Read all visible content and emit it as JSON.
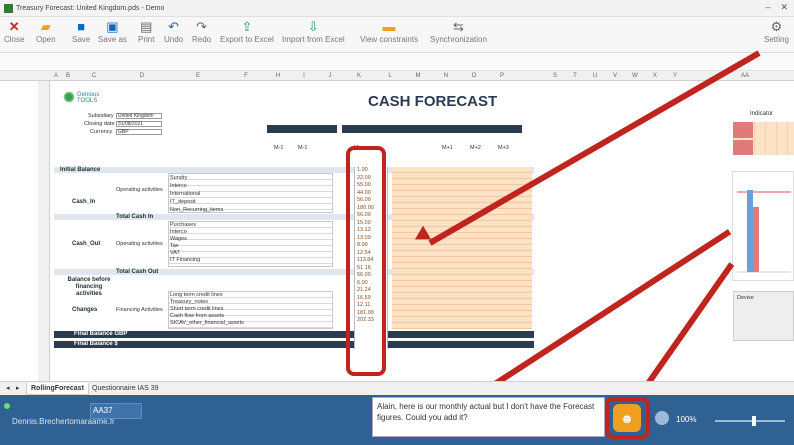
{
  "window": {
    "title": "Treasury Forecast: United Kingdom.pds - Demo",
    "controls": [
      "–",
      "✕"
    ]
  },
  "toolbar": {
    "close": "Close",
    "open": "Open",
    "save": "Save",
    "save_as": "Save as",
    "print": "Print",
    "undo": "Undo",
    "redo": "Redo",
    "export": "Export to Excel",
    "import": "Import from Excel",
    "view_constraints": "View constraints",
    "synchronization": "Synchronization",
    "settings": "Setting"
  },
  "sheet": {
    "logo_text": "Genious TOOLS",
    "title": "CASH FORECAST",
    "subsidiary_label": "Subsidiary",
    "subsidiary_value": "United Kingdom",
    "closing_date_label": "Closing date",
    "closing_date_value": "31/08/2021",
    "currency_label": "Currency",
    "currency_value": "GBP",
    "col_actual_1": "Actual",
    "col_forecast_1": "Forecast",
    "col_actual_2": "Actual",
    "col_forecast_2": "Forecast",
    "col_forecast_3": "Forecast",
    "m_minus_1": "M-1",
    "m": "M",
    "m_plus_1": "M+1",
    "m_plus_2": "M+2",
    "m_plus_3": "M+3",
    "initial_balance": "Initial Balance",
    "cash_in": "Cash_In",
    "operating_activities": "Operating activities",
    "total_cash_in": "Total Cash In",
    "cash_out": "Cash_Out",
    "total_cash_out": "Total Cash Out",
    "balance_before": "Balance before financing activities",
    "changes": "Changes",
    "financing_activities": "Financing Activities",
    "final_balance_gbp": "Final Balance GBP",
    "final_balance": "Final Balance $",
    "indicator_label": "Indicator",
    "cash_in_items": [
      "Sundry",
      "Interco",
      "International",
      "IT_deposit",
      "Non_Recurring_items"
    ],
    "cash_out_items": [
      "Purchases",
      "Interco",
      "Wages",
      "Tax",
      "VAT",
      "IT Financing"
    ],
    "financing_items": [
      "Long term credit lines",
      "Treasury_notes",
      "Short term credit lines",
      "Cash flow from assets",
      "SICAV_other_financial_assets"
    ],
    "actual_values": [
      "1.00",
      "22.00",
      "55.00",
      "44.00",
      "56.00",
      "180.00",
      "56.00",
      "15.00",
      "13.12",
      "13.09",
      "8.99",
      "12.54",
      "113.84",
      "51.16",
      "56.00",
      "6.00",
      "21.24",
      "16.59",
      "12.11",
      "181.00",
      "202.33"
    ],
    "fx_label": "Devise"
  },
  "tabs": {
    "rolling": "RollingForecast",
    "questionnaire": "Questionnaire IAS 39"
  },
  "status": {
    "user": "Dennis.Brechertomaraame.fr",
    "cell_ref": "AA37",
    "comment": "Alain, here is our monthly actual but I don't have the Forecast figures. Could you add it?",
    "zoom": "100%"
  },
  "colors": {
    "highlight": "#c0241e",
    "statusbar": "#2f6193",
    "forecast_fill": "#fde2c6",
    "header_dark": "#2d3b52"
  }
}
